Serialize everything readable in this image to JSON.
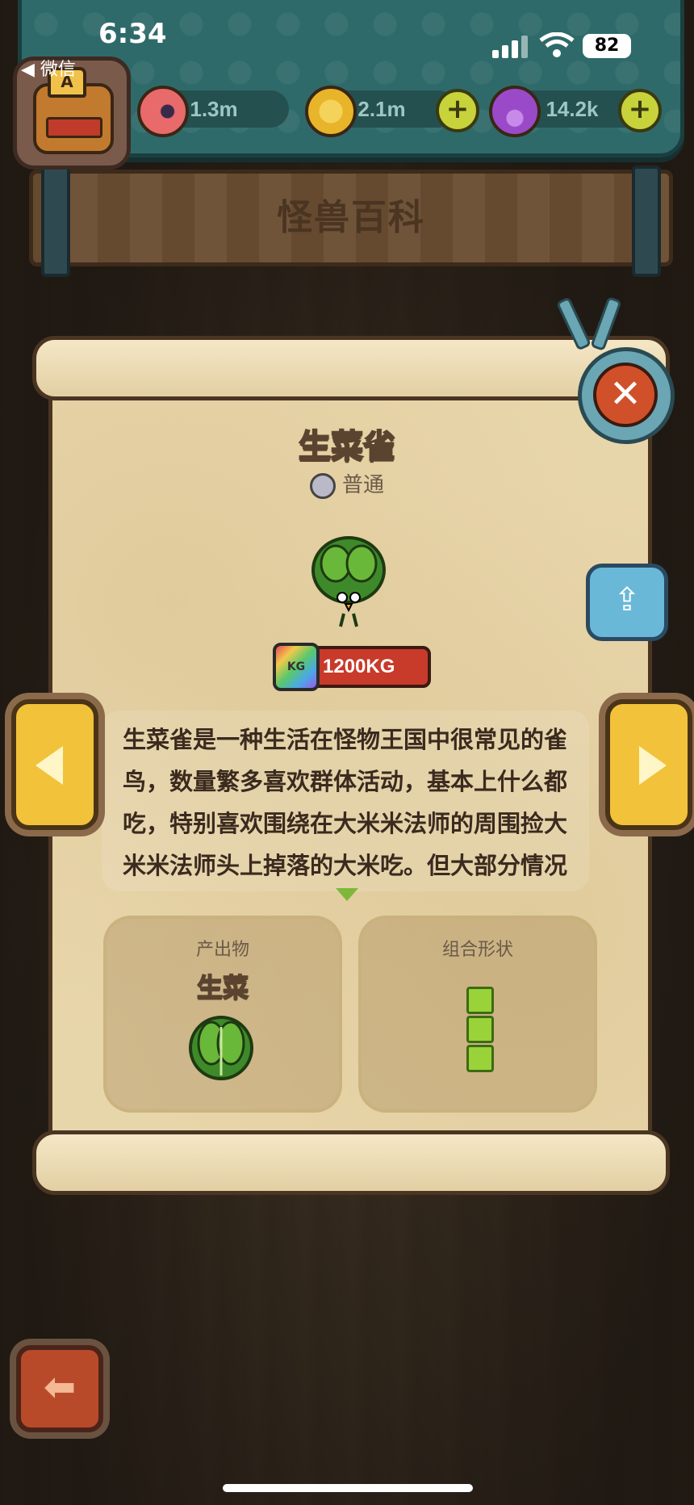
{
  "status_bar": {
    "time": "6:34",
    "back_app": "◀ 微信",
    "battery": "82"
  },
  "resources": [
    {
      "name": "eyeball",
      "value": "1.3m",
      "color": "#e86a6a"
    },
    {
      "name": "coin",
      "value": "2.1m",
      "color": "#e8b42a"
    },
    {
      "name": "potion",
      "value": "14.2k",
      "color": "#9a4ac8"
    }
  ],
  "avatar": {
    "letter": "A"
  },
  "page_title": "怪兽百科",
  "monster": {
    "name": "生菜雀",
    "rarity": "普通",
    "weight": "1200KG",
    "weight_badge": "KG",
    "description": "生菜雀是一种生活在怪物王国中很常见的雀鸟，数量繁多喜欢群体活动，基本上什么都吃，特别喜欢围绕在大米米法师的周围捡大米米法师头上掉落的大米吃。但大部分情况下食物匮乏，它们也能够依靠头顶上的生菜叶进行光合作用合成养分，可以说是生存能力很强的"
  },
  "output_card": {
    "title": "产出物",
    "value": "生菜"
  },
  "shape_card": {
    "title": "组合形状",
    "cells": 3
  },
  "colors": {
    "accent_green": "#9ad23a",
    "close_red": "#d0502a",
    "parchment": "#e8d6ab",
    "panel_teal": "#2f6a6a"
  },
  "icons": [
    "close-icon",
    "share-icon",
    "left-arrow-icon",
    "right-arrow-icon",
    "back-arrow-icon"
  ]
}
